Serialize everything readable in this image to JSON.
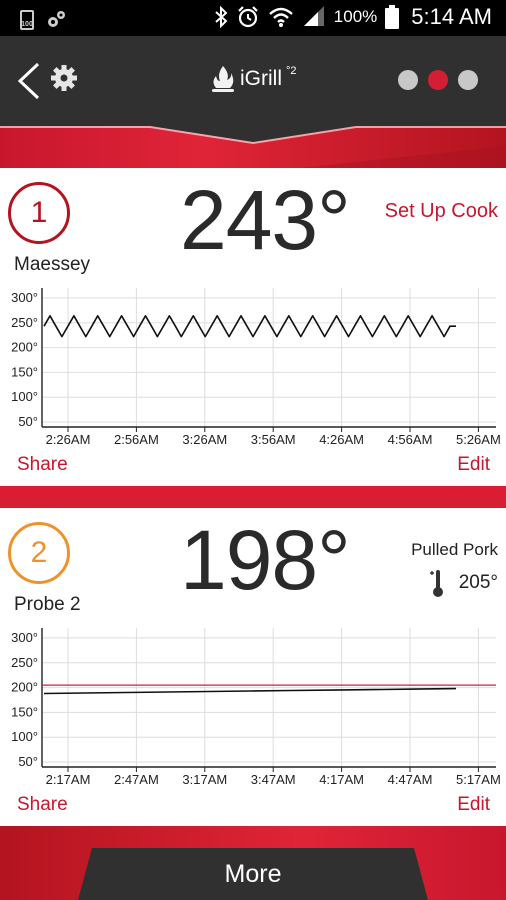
{
  "status_bar": {
    "battery_small_label": "100",
    "battery_percent": "100%",
    "time": "5:14 AM"
  },
  "app_bar": {
    "brand_name": "iGrill",
    "brand_sup": "°2",
    "page_dots": [
      {
        "active": false
      },
      {
        "active": true
      },
      {
        "active": false
      }
    ]
  },
  "probe1": {
    "number": "1",
    "ring_color": "#b3141f",
    "name": "Maessey",
    "temperature": "243°",
    "setup_label": "Set Up Cook",
    "share_label": "Share",
    "edit_label": "Edit"
  },
  "probe2": {
    "number": "2",
    "ring_color": "#f0922b",
    "name": "Probe 2",
    "temperature": "198°",
    "preset_name": "Pulled Pork",
    "target_temp": "205°",
    "share_label": "Share",
    "edit_label": "Edit"
  },
  "bottom": {
    "more_label": "More"
  },
  "chart_data": [
    {
      "type": "line",
      "y_ticks": [
        "300°",
        "250°",
        "200°",
        "150°",
        "100°",
        "50°"
      ],
      "y_tick_values": [
        300,
        250,
        200,
        150,
        100,
        50
      ],
      "ylim": [
        40,
        320
      ],
      "x_ticks": [
        "2:26AM",
        "2:56AM",
        "3:26AM",
        "3:56AM",
        "4:26AM",
        "4:56AM",
        "5:26AM"
      ],
      "grid": true,
      "series": [
        {
          "color": "#111111",
          "x_start": "2:26AM",
          "x_end": "5:14AM",
          "values": [
            243,
            264,
            243,
            222,
            243,
            264,
            243,
            222,
            243,
            264,
            243,
            222,
            243,
            264,
            243,
            222,
            243,
            264,
            243,
            222,
            243,
            264,
            243,
            222,
            243,
            264,
            243,
            222,
            243,
            264,
            243,
            222,
            243,
            264,
            243,
            222,
            243,
            264,
            243,
            222,
            243,
            264,
            243,
            222,
            243,
            264,
            243,
            222,
            243,
            264,
            243,
            222,
            243,
            264,
            243,
            222,
            243,
            264,
            243,
            222,
            243,
            264,
            243,
            222,
            243,
            264,
            243,
            222,
            243,
            243
          ]
        }
      ]
    },
    {
      "type": "line",
      "y_ticks": [
        "300°",
        "250°",
        "200°",
        "150°",
        "100°",
        "50°"
      ],
      "y_tick_values": [
        300,
        250,
        200,
        150,
        100,
        50
      ],
      "ylim": [
        40,
        320
      ],
      "x_ticks": [
        "2:17AM",
        "2:47AM",
        "3:17AM",
        "3:47AM",
        "4:17AM",
        "4:47AM",
        "5:17AM"
      ],
      "grid": true,
      "target_line": {
        "value": 205,
        "color": "#d41e33"
      },
      "series": [
        {
          "color": "#111111",
          "x_start": "2:17AM",
          "x_end": "5:14AM",
          "values": [
            188,
            189,
            190,
            191,
            192,
            193,
            194,
            195,
            196,
            197,
            198
          ]
        }
      ]
    }
  ]
}
